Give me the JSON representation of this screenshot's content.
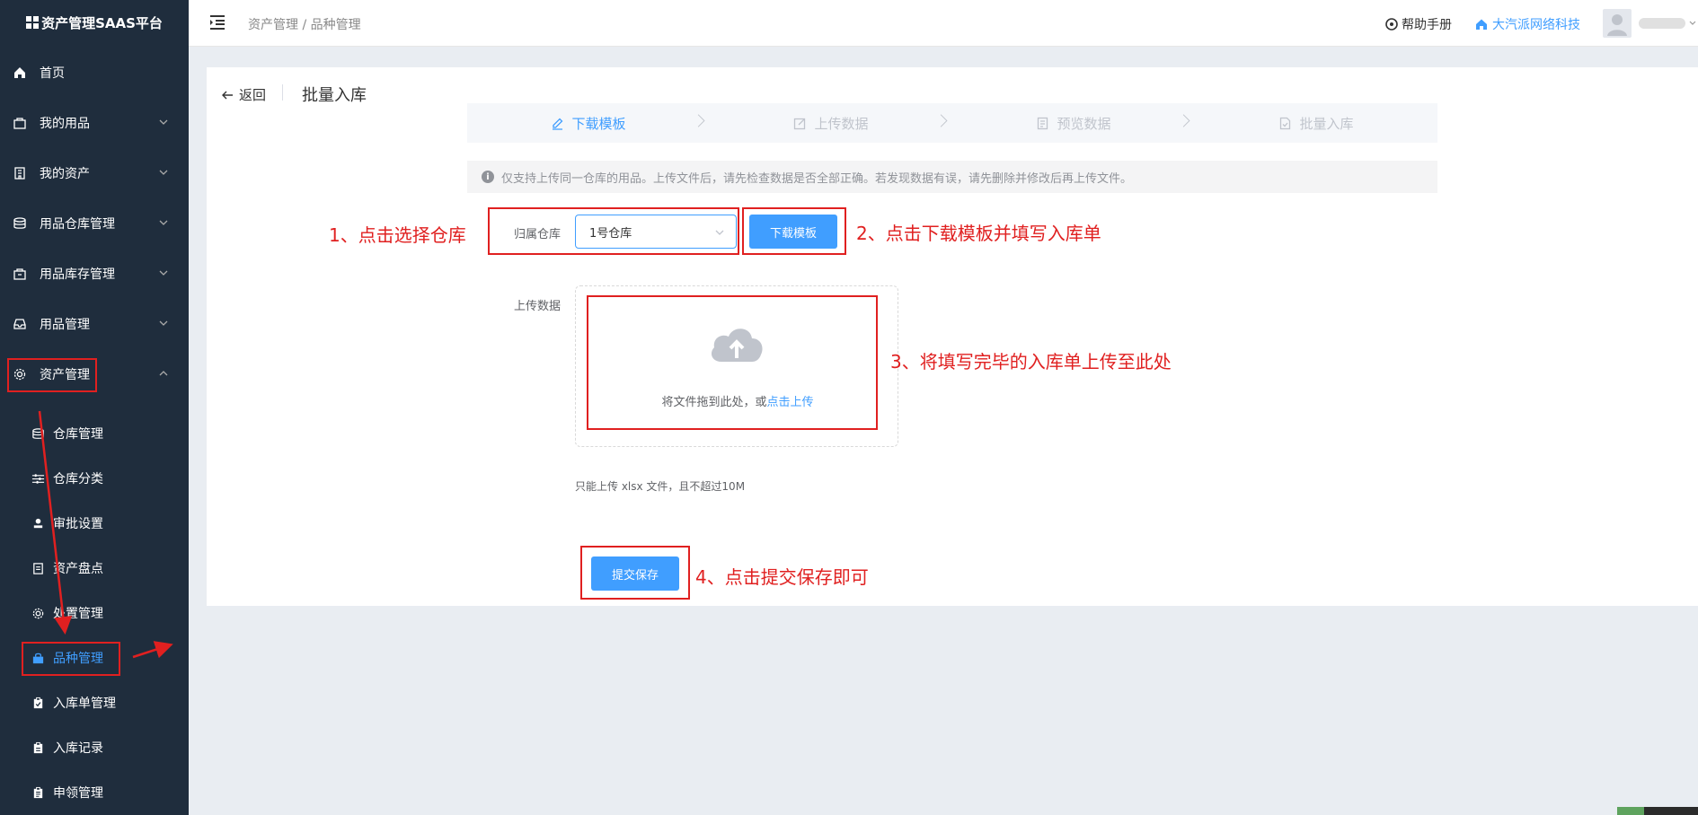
{
  "app": {
    "title": "资产管理SAAS平台"
  },
  "sidebar": {
    "menu": [
      {
        "label": "首页",
        "icon": "home-icon"
      },
      {
        "label": "我的用品",
        "icon": "bag-icon"
      },
      {
        "label": "我的资产",
        "icon": "building-icon"
      },
      {
        "label": "用品仓库管理",
        "icon": "database-icon"
      },
      {
        "label": "用品库存管理",
        "icon": "box-icon"
      },
      {
        "label": "用品管理",
        "icon": "inbox-icon"
      },
      {
        "label": "资产管理",
        "icon": "cog-icon"
      }
    ],
    "submenu": [
      {
        "label": "仓库管理",
        "icon": "database-icon"
      },
      {
        "label": "仓库分类",
        "icon": "sliders-icon"
      },
      {
        "label": "审批设置",
        "icon": "stamp-icon"
      },
      {
        "label": "资产盘点",
        "icon": "document-icon"
      },
      {
        "label": "处置管理",
        "icon": "gear-icon"
      },
      {
        "label": "品种管理",
        "icon": "shopping-bag-icon"
      },
      {
        "label": "入库单管理",
        "icon": "clipboard-check-icon"
      },
      {
        "label": "入库记录",
        "icon": "clipboard-icon"
      },
      {
        "label": "申领管理",
        "icon": "clipboard-list-icon"
      }
    ]
  },
  "header": {
    "breadcrumb": "资产管理 / 品种管理",
    "help": "帮助手册",
    "company": "大汽派网络科技"
  },
  "page": {
    "back": "返回",
    "title": "批量入库",
    "steps": [
      "下载模板",
      "上传数据",
      "预览数据",
      "批量入库"
    ],
    "alert": "仅支持上传同一仓库的用品。上传文件后，请先检查数据是否全部正确。若发现数据有误，请先删除并修改后再上传文件。",
    "warehouse_label": "归属仓库",
    "warehouse_value": "1号仓库",
    "download_button": "下载模板",
    "upload_label": "上传数据",
    "upload_text": "将文件拖到此处，或",
    "upload_link": "点击上传",
    "tip": "只能上传 xlsx 文件，且不超过10M",
    "submit_button": "提交保存"
  },
  "annotations": {
    "note1": "1、点击选择仓库",
    "note2": "2、点击下载模板并填写入库单",
    "note3": "3、将填写完毕的入库单上传至此处",
    "note4": "4、点击提交保存即可"
  },
  "colors": {
    "sidebar_bg": "#1f2d3d",
    "accent": "#409eff",
    "annotation": "#e02020"
  }
}
